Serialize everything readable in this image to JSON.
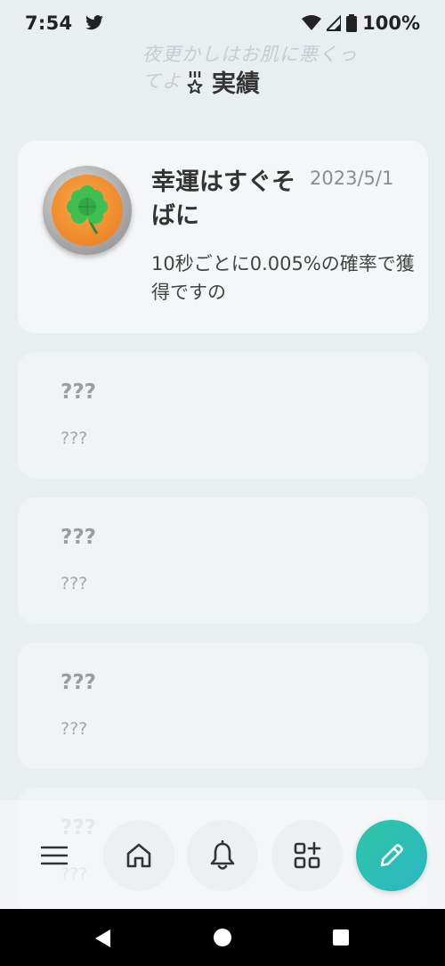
{
  "status_bar": {
    "time": "7:54",
    "battery": "100%",
    "icons": [
      "twitter-icon",
      "wifi-icon",
      "signal-icon",
      "battery-icon"
    ]
  },
  "header": {
    "faded_note_line1": "夜更かしはお肌に悪くっ",
    "faded_note_line2": "てよ",
    "title": "実績",
    "icon": "medal-icon"
  },
  "achievements": [
    {
      "state": "unlocked",
      "title": "幸運はすぐそばに",
      "date": "2023/5/1",
      "description": "10秒ごとに0.005%の確率で獲得ですの",
      "icon": "four-leaf-clover-icon"
    },
    {
      "state": "locked",
      "title": "???",
      "description": "???"
    },
    {
      "state": "locked",
      "title": "???",
      "description": "???"
    },
    {
      "state": "locked",
      "title": "???",
      "description": "???"
    },
    {
      "state": "locked",
      "title": "???",
      "description": "???"
    }
  ],
  "bottom_nav": {
    "items": [
      "menu-icon",
      "home-icon",
      "bell-icon",
      "widgets-icon"
    ],
    "fab_icon": "pencil-icon",
    "fab_color": "#2ec7a6"
  },
  "system_nav": [
    "back",
    "home",
    "recents"
  ]
}
